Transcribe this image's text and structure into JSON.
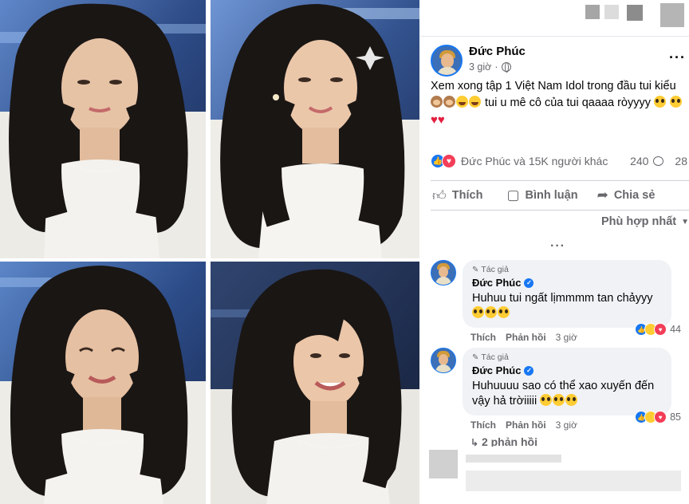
{
  "post": {
    "author": "Đức Phúc",
    "time": "3 giờ",
    "text": "Xem xong tập 1 Việt Nam Idol trong đầu tui kiểu",
    "text_tail": "tui u mê cô của tui qaaaa ròyyyy",
    "reactions_text": "Đức Phúc và 15K người khác",
    "comment_count": "240",
    "share_count": "28"
  },
  "actions": {
    "like": "Thích",
    "comment": "Bình luận",
    "share": "Chia sẻ"
  },
  "sort_label": "Phù hợp nhất",
  "comments": [
    {
      "badge": "Tác giả",
      "name": "Đức Phúc",
      "text": "Huhuu tui ngất lịmmmm tan chảyyy",
      "like": "Thích",
      "reply": "Phản hồi",
      "time": "3 giờ",
      "reaction_count": "44"
    },
    {
      "badge": "Tác giả",
      "name": "Đức Phúc",
      "text": "Huhuuuu sao có thể xao xuyến đến vậy hả trờiiiii",
      "like": "Thích",
      "reply": "Phản hồi",
      "time": "3 giờ",
      "reaction_count": "85"
    }
  ],
  "replies_label": "2 phản hồi",
  "icons": [
    "globe-icon",
    "more-options-icon",
    "like-icon",
    "comment-icon",
    "share-icon",
    "verified-icon",
    "pen-icon",
    "caret-down-icon"
  ],
  "colors": {
    "accent": "#1877f2",
    "love": "#f33e58",
    "muted": "#65676b",
    "bubble": "#f0f2f5"
  }
}
